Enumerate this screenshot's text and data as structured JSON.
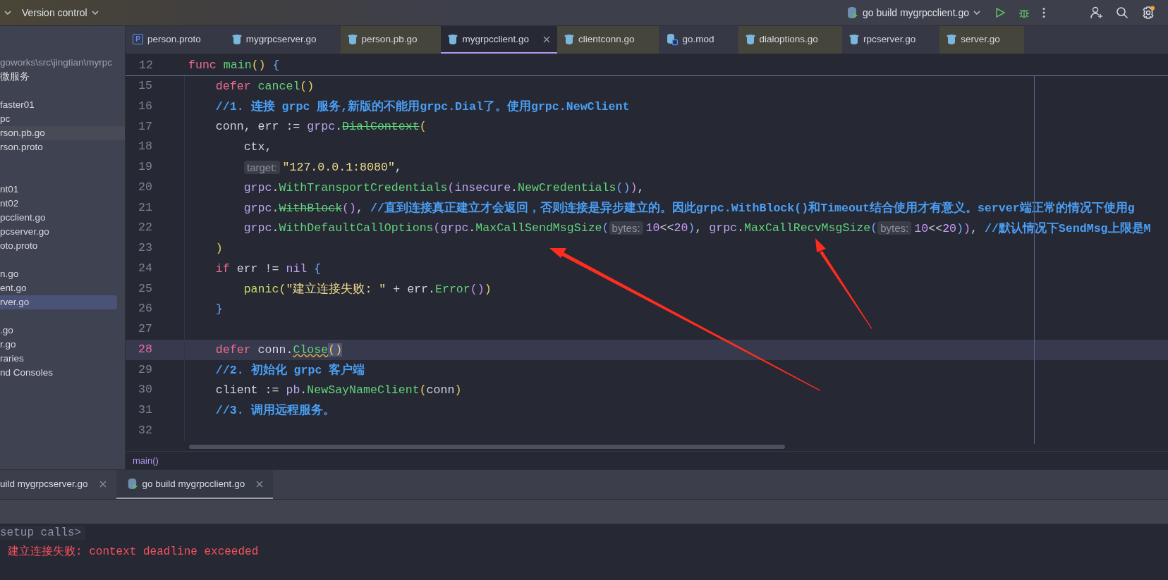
{
  "title_bar": {
    "vcs_label": "Version control",
    "run_config": "go build mygrpcclient.go"
  },
  "editor_tabs": [
    {
      "label": "person.proto",
      "kind": "proto",
      "icon_letter": "P",
      "selected": false,
      "external": false
    },
    {
      "label": "mygrpcserver.go",
      "kind": "go",
      "selected": false,
      "external": false
    },
    {
      "label": "person.pb.go",
      "kind": "go",
      "selected": false,
      "external": true
    },
    {
      "label": "mygrpcclient.go",
      "kind": "go",
      "selected": true,
      "external": false
    },
    {
      "label": "clientconn.go",
      "kind": "go",
      "selected": false,
      "external": true
    },
    {
      "label": "go.mod",
      "kind": "mod",
      "selected": false,
      "external": false
    },
    {
      "label": "dialoptions.go",
      "kind": "go",
      "selected": false,
      "external": true
    },
    {
      "label": "rpcserver.go",
      "kind": "go",
      "selected": false,
      "external": false
    },
    {
      "label": "server.go",
      "kind": "go",
      "selected": false,
      "external": true
    }
  ],
  "project_tree": {
    "groups": [
      {
        "items": [
          {
            "label": "goworks\\src\\jingtian\\myrpc",
            "kind": "path",
            "selected": false,
            "highlighted": false
          },
          {
            "label": "微服务",
            "kind": "node",
            "selected": false,
            "highlighted": false
          }
        ]
      },
      {
        "items": [
          {
            "label": "faster01",
            "kind": "node",
            "selected": false,
            "highlighted": false
          },
          {
            "label": "pc",
            "kind": "node",
            "selected": false,
            "highlighted": false
          },
          {
            "label": "rson.pb.go",
            "kind": "node",
            "selected": false,
            "highlighted": true
          },
          {
            "label": "rson.proto",
            "kind": "node",
            "selected": false,
            "highlighted": false
          }
        ]
      },
      {
        "items": [
          {
            "label": "nt01",
            "kind": "node",
            "selected": false,
            "highlighted": false
          },
          {
            "label": "nt02",
            "kind": "node",
            "selected": false,
            "highlighted": false
          },
          {
            "label": "pcclient.go",
            "kind": "node",
            "selected": false,
            "highlighted": false
          },
          {
            "label": "pcserver.go",
            "kind": "node",
            "selected": false,
            "highlighted": false
          },
          {
            "label": "oto.proto",
            "kind": "node",
            "selected": false,
            "highlighted": false
          }
        ]
      },
      {
        "items": [
          {
            "label": "n.go",
            "kind": "node",
            "selected": false,
            "highlighted": false
          },
          {
            "label": "ent.go",
            "kind": "node",
            "selected": false,
            "highlighted": false
          },
          {
            "label": "rver.go",
            "kind": "node",
            "selected": true,
            "highlighted": false
          }
        ]
      },
      {
        "items": [
          {
            "label": ".go",
            "kind": "node",
            "selected": false,
            "highlighted": false
          },
          {
            "label": "r.go",
            "kind": "node",
            "selected": false,
            "highlighted": false
          },
          {
            "label": "raries",
            "kind": "node",
            "selected": false,
            "highlighted": false
          },
          {
            "label": "nd Consoles",
            "kind": "node",
            "selected": false,
            "highlighted": false
          }
        ]
      }
    ]
  },
  "editor": {
    "sticky_line": {
      "number": "12",
      "tokens": [
        {
          "kind": "keyword",
          "text": "func "
        },
        {
          "kind": "function",
          "text": "main"
        },
        {
          "kind": "bracket1",
          "text": "() "
        },
        {
          "kind": "bracket3",
          "text": "{"
        }
      ]
    },
    "lines": [
      {
        "number": "15",
        "current": false,
        "tokens": [
          {
            "kind": "keyword",
            "text": "    defer "
          },
          {
            "kind": "function",
            "text": "cancel"
          },
          {
            "kind": "bracket1",
            "text": "()"
          }
        ]
      },
      {
        "number": "16",
        "current": false,
        "tokens": [
          {
            "kind": "comment",
            "text": "    //1. 连接 grpc 服务,新版的不能用grpc.Dial了。使用grpc.NewClient"
          }
        ]
      },
      {
        "number": "17",
        "current": false,
        "tokens": [
          {
            "kind": "plain",
            "text": "    conn, err := "
          },
          {
            "kind": "package",
            "text": "grpc"
          },
          {
            "kind": "plain",
            "text": "."
          },
          {
            "kind": "deprecated",
            "text": "DialContext"
          },
          {
            "kind": "bracket1",
            "text": "("
          }
        ]
      },
      {
        "number": "18",
        "current": false,
        "tokens": [
          {
            "kind": "plain",
            "text": "        ctx,"
          }
        ]
      },
      {
        "number": "19",
        "current": false,
        "tokens": [
          {
            "kind": "hint",
            "text": "target:"
          },
          {
            "kind": "string",
            "text": "\"127.0.0.1:8080\""
          },
          {
            "kind": "plain",
            "text": ","
          }
        ]
      },
      {
        "number": "20",
        "current": false,
        "tokens": [
          {
            "kind": "package",
            "text": "        grpc"
          },
          {
            "kind": "plain",
            "text": "."
          },
          {
            "kind": "function",
            "text": "WithTransportCredentials"
          },
          {
            "kind": "bracket2",
            "text": "("
          },
          {
            "kind": "package",
            "text": "insecure"
          },
          {
            "kind": "plain",
            "text": "."
          },
          {
            "kind": "function",
            "text": "NewCredentials"
          },
          {
            "kind": "bracket3",
            "text": "()"
          },
          {
            "kind": "bracket2",
            "text": ")"
          },
          {
            "kind": "plain",
            "text": ","
          }
        ]
      },
      {
        "number": "21",
        "current": false,
        "tokens": [
          {
            "kind": "package",
            "text": "        grpc"
          },
          {
            "kind": "plain",
            "text": "."
          },
          {
            "kind": "deprecated",
            "text": "WithBlock"
          },
          {
            "kind": "bracket2",
            "text": "()"
          },
          {
            "kind": "plain",
            "text": ", "
          },
          {
            "kind": "comment",
            "text": "//直到连接真正建立才会返回，否则连接是异步建立的。因此grpc.WithBlock()和Timeout结合使用才有意义。server端正常的情况下使用g"
          }
        ]
      },
      {
        "number": "22",
        "current": false,
        "tokens": [
          {
            "kind": "package",
            "text": "        grpc"
          },
          {
            "kind": "plain",
            "text": "."
          },
          {
            "kind": "function",
            "text": "WithDefaultCallOptions"
          },
          {
            "kind": "bracket2",
            "text": "("
          },
          {
            "kind": "package",
            "text": "grpc"
          },
          {
            "kind": "plain",
            "text": "."
          },
          {
            "kind": "function",
            "text": "MaxCallSendMsgSize"
          },
          {
            "kind": "bracket3",
            "text": "("
          },
          {
            "kind": "hint",
            "text": "bytes:"
          },
          {
            "kind": "number",
            "text": "10"
          },
          {
            "kind": "plain",
            "text": "<<"
          },
          {
            "kind": "number",
            "text": "20"
          },
          {
            "kind": "bracket3",
            "text": ")"
          },
          {
            "kind": "plain",
            "text": ", "
          },
          {
            "kind": "package",
            "text": "grpc"
          },
          {
            "kind": "plain",
            "text": "."
          },
          {
            "kind": "function",
            "text": "MaxCallRecvMsgSize"
          },
          {
            "kind": "bracket3",
            "text": "("
          },
          {
            "kind": "hint",
            "text": "bytes:"
          },
          {
            "kind": "number",
            "text": "10"
          },
          {
            "kind": "plain",
            "text": "<<"
          },
          {
            "kind": "number",
            "text": "20"
          },
          {
            "kind": "bracket3",
            "text": ")"
          },
          {
            "kind": "bracket2",
            "text": ")"
          },
          {
            "kind": "plain",
            "text": ", "
          },
          {
            "kind": "comment",
            "text": "//默认情况下SendMsg上限是M"
          }
        ]
      },
      {
        "number": "23",
        "current": false,
        "tokens": [
          {
            "kind": "bracket1",
            "text": "    )"
          }
        ]
      },
      {
        "number": "24",
        "current": false,
        "tokens": [
          {
            "kind": "keyword",
            "text": "    if"
          },
          {
            "kind": "plain",
            "text": " err != "
          },
          {
            "kind": "constant",
            "text": "nil "
          },
          {
            "kind": "bracket3",
            "text": "{"
          }
        ]
      },
      {
        "number": "25",
        "current": false,
        "tokens": [
          {
            "kind": "builtin",
            "text": "        panic"
          },
          {
            "kind": "bracket1",
            "text": "("
          },
          {
            "kind": "string",
            "text": "\"建立连接失败: \""
          },
          {
            "kind": "plain",
            "text": " + err."
          },
          {
            "kind": "function",
            "text": "Error"
          },
          {
            "kind": "bracket2",
            "text": "()"
          },
          {
            "kind": "bracket1",
            "text": ")"
          }
        ]
      },
      {
        "number": "26",
        "current": false,
        "tokens": [
          {
            "kind": "bracket3",
            "text": "    }"
          }
        ]
      },
      {
        "number": "27",
        "current": false
      },
      {
        "number": "28",
        "current": true,
        "tokens": [
          {
            "kind": "keyword",
            "text": "    defer"
          },
          {
            "kind": "plain",
            "text": " conn."
          },
          {
            "kind": "function-warned",
            "text": "Close"
          },
          {
            "kind": "bracket-matched",
            "text": "()"
          }
        ]
      },
      {
        "number": "29",
        "current": false,
        "tokens": [
          {
            "kind": "comment",
            "text": "    //2. 初始化 grpc 客户端"
          }
        ]
      },
      {
        "number": "30",
        "current": false,
        "tokens": [
          {
            "kind": "plain",
            "text": "    client := "
          },
          {
            "kind": "package",
            "text": "pb"
          },
          {
            "kind": "plain",
            "text": "."
          },
          {
            "kind": "function",
            "text": "NewSayNameClient"
          },
          {
            "kind": "bracket1",
            "text": "("
          },
          {
            "kind": "plain",
            "text": "conn"
          },
          {
            "kind": "bracket1",
            "text": ")"
          }
        ]
      },
      {
        "number": "31",
        "current": false,
        "tokens": [
          {
            "kind": "comment",
            "text": "    //3. 调用远程服务。"
          }
        ]
      },
      {
        "number": "32",
        "current": false
      }
    ],
    "breadcrumb": "main()"
  },
  "run_panel": {
    "tabs": [
      {
        "label": "uild mygrpcserver.go",
        "selected": false,
        "icon": false
      },
      {
        "label": "go build mygrpcclient.go",
        "selected": true,
        "icon": true
      }
    ],
    "console": [
      {
        "kind": "prompt",
        "text": "setup calls>"
      },
      {
        "kind": "error",
        "text": "建立连接失败: context deadline exceeded"
      }
    ]
  }
}
